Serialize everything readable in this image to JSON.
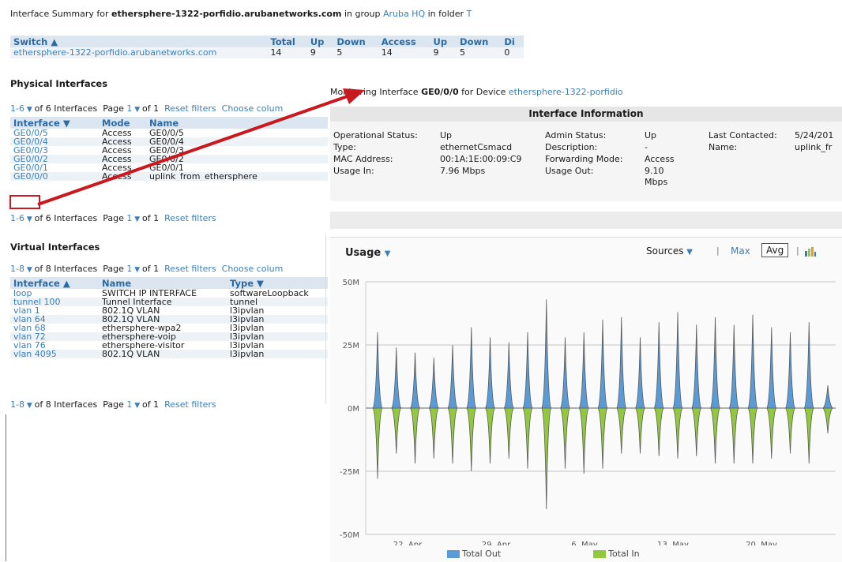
{
  "summary": {
    "prefix": "Interface Summary for",
    "device": "ethersphere-1322-porfidio.arubanetworks.com",
    "group_text": "in group",
    "group": "Aruba HQ",
    "folder_text": "in folder",
    "folder": "T"
  },
  "switch_table": {
    "headers": [
      "Switch ▲",
      "Total",
      "Up",
      "Down",
      "Access",
      "Up",
      "Down",
      "Di"
    ],
    "row": [
      "ethersphere-1322-porfidio.arubanetworks.com",
      "14",
      "9",
      "5",
      "14",
      "9",
      "5",
      "0"
    ]
  },
  "physical": {
    "title": "Physical Interfaces",
    "pager_top": {
      "range": "1-6",
      "text": "of 6 Interfaces",
      "page_label": "Page",
      "page": "1",
      "of": "of 1",
      "reset": "Reset filters",
      "choose": "Choose colum"
    },
    "pager_bottom": {
      "range": "1-6",
      "text": "of 6 Interfaces",
      "page_label": "Page",
      "page": "1",
      "of": "of 1",
      "reset": "Reset filters"
    },
    "headers": [
      "Interface ▼",
      "Mode",
      "Name"
    ],
    "rows": [
      [
        "GE0/0/5",
        "Access",
        "GE0/0/5"
      ],
      [
        "GE0/0/4",
        "Access",
        "GE0/0/4"
      ],
      [
        "GE0/0/3",
        "Access",
        "GE0/0/3"
      ],
      [
        "GE0/0/2",
        "Access",
        "GE0/0/2"
      ],
      [
        "GE0/0/1",
        "Access",
        "GE0/0/1"
      ],
      [
        "GE0/0/0",
        "Access",
        "uplink_from_ethersphere"
      ]
    ]
  },
  "virtual": {
    "title": "Virtual Interfaces",
    "pager_top": {
      "range": "1-8",
      "text": "of 8 Interfaces",
      "page_label": "Page",
      "page": "1",
      "of": "of 1",
      "reset": "Reset filters",
      "choose": "Choose colum"
    },
    "pager_bottom": {
      "range": "1-8",
      "text": "of 8 Interfaces",
      "page_label": "Page",
      "page": "1",
      "of": "of 1",
      "reset": "Reset filters"
    },
    "headers": [
      "Interface ▲",
      "Name",
      "Type ▼"
    ],
    "rows": [
      [
        "loop",
        "SWITCH IP INTERFACE",
        "softwareLoopback"
      ],
      [
        "tunnel 100",
        "Tunnel Interface",
        "tunnel"
      ],
      [
        "vlan 1",
        "802.1Q VLAN",
        "l3ipvlan"
      ],
      [
        "vlan 64",
        "802.1Q VLAN",
        "l3ipvlan"
      ],
      [
        "vlan 68",
        "ethersphere-wpa2",
        "l3ipvlan"
      ],
      [
        "vlan 72",
        "ethersphere-voip",
        "l3ipvlan"
      ],
      [
        "vlan 76",
        "ethersphere-visitor",
        "l3ipvlan"
      ],
      [
        "vlan 4095",
        "802.1Q VLAN",
        "l3ipvlan"
      ]
    ]
  },
  "monitor": {
    "prefix": "Monitoring Interface",
    "iface": "GE0/0/0",
    "mid": "for Device",
    "device": "ethersphere-1322-porfidio"
  },
  "info": {
    "title": "Interface Information",
    "col1": [
      {
        "label": "Operational Status:",
        "value": "Up"
      },
      {
        "label": "Type:",
        "value": "ethernetCsmacd"
      },
      {
        "label": "MAC Address:",
        "value": "00:1A:1E:00:09:C9"
      },
      {
        "label": "Usage In:",
        "value": "7.96 Mbps"
      }
    ],
    "col2": [
      {
        "label": "Admin Status:",
        "value": "Up"
      },
      {
        "label": "Description:",
        "value": "-"
      },
      {
        "label": "Forwarding Mode:",
        "value": "Access"
      },
      {
        "label": "Usage Out:",
        "value": "9.10 Mbps"
      }
    ],
    "col3": [
      {
        "label": "Last Contacted:",
        "value": "5/24/201"
      },
      {
        "label": "Name:",
        "value": "uplink_fr"
      }
    ]
  },
  "usage": {
    "title": "Usage",
    "sources": "Sources",
    "max": "Max",
    "avg": "Avg",
    "legend": [
      "Total Out",
      "Total In"
    ]
  },
  "colors": {
    "out": "#5b9bd5",
    "in": "#92c83e",
    "accent": "#3b7fb6",
    "highlight": "#c9191e"
  },
  "chart_data": {
    "type": "area",
    "title": "Usage",
    "y_ticks": [
      "50M",
      "25M",
      "0M",
      "-25M",
      "-50M"
    ],
    "ylim": [
      -50,
      50
    ],
    "x_ticks": [
      "22. Apr",
      "29. Apr",
      "6. May",
      "13. May",
      "20. May"
    ],
    "series": [
      {
        "name": "Total Out",
        "values": [
          30,
          24,
          22,
          20,
          25,
          32,
          28,
          26,
          30,
          43,
          28,
          30,
          35,
          36,
          28,
          34,
          38,
          33,
          36,
          33,
          37,
          32,
          30,
          34,
          9
        ]
      },
      {
        "name": "Total In",
        "values": [
          -28,
          -18,
          -22,
          -20,
          -22,
          -25,
          -22,
          -20,
          -24,
          -40,
          -24,
          -26,
          -24,
          -18,
          -18,
          -19,
          -20,
          -19,
          -22,
          -22,
          -22,
          -20,
          -18,
          -22,
          -10
        ]
      }
    ]
  }
}
